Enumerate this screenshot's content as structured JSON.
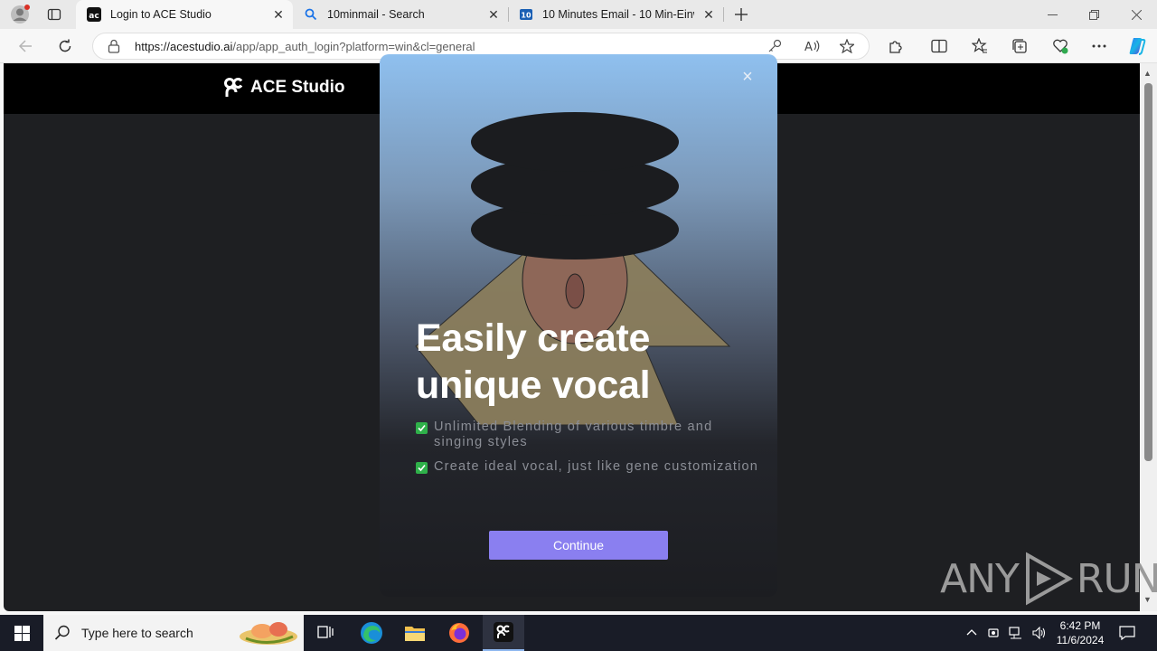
{
  "browser": {
    "tabs": [
      {
        "label": "Login to ACE Studio",
        "active": true
      },
      {
        "label": "10minmail - Search",
        "active": false
      },
      {
        "label": "10 Minutes Email - 10 Min-Einwe",
        "active": false
      }
    ],
    "address": {
      "url_host": "https://acestudio.ai",
      "url_path": "/app/app_auth_login?platform=win&cl=general"
    }
  },
  "site": {
    "logo_text": "ACE Studio"
  },
  "modal": {
    "title_line1": "Easily create",
    "title_line2": "unique vocal",
    "features": [
      "Unlimited Blending of various timbre and singing styles",
      "Create ideal vocal, just like gene customization"
    ],
    "cta_label": "Continue",
    "close_glyph": "×"
  },
  "watermark": {
    "text_left": "ANY",
    "text_right": "RUN"
  },
  "taskbar": {
    "search_placeholder": "Type here to search",
    "time": "6:42 PM",
    "date": "11/6/2024"
  },
  "colors": {
    "cta": "#8a7ff0",
    "page_bg": "#1e1f22",
    "taskbar": "#191c27",
    "check": "#2fb14a"
  }
}
